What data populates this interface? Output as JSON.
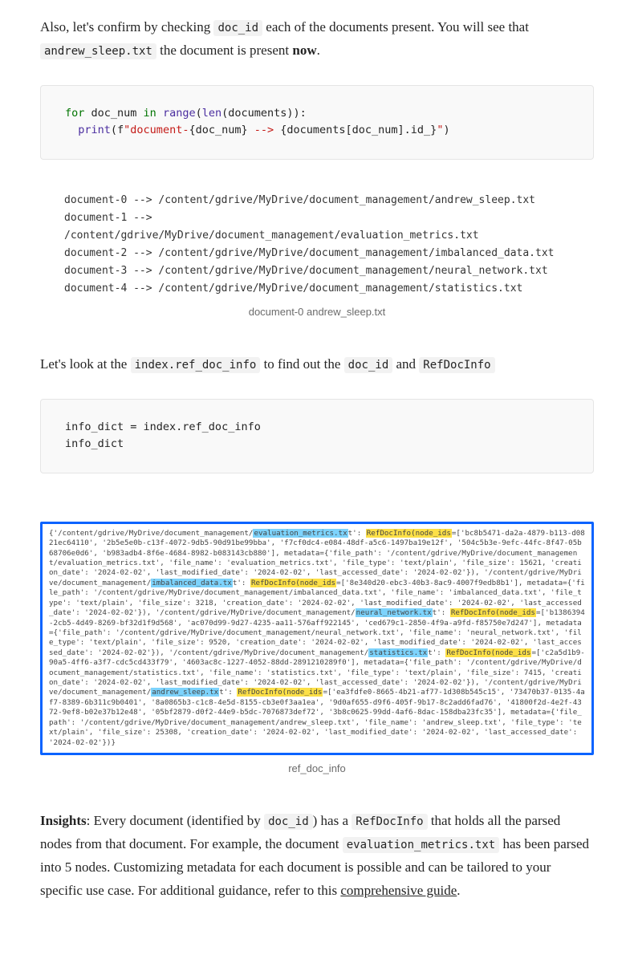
{
  "p1_a": "Also, let's confirm by checking ",
  "p1_b": " each of the documents present. You will see that ",
  "p1_c": " the document is present ",
  "p1_d": ".",
  "doc_id": "doc_id",
  "andrew_file": "andrew_sleep.txt",
  "now": "now",
  "code1": {
    "l1a": "for",
    "l1b": " doc_num ",
    "l1c": "in",
    "l1d": " ",
    "l1e": "range",
    "l1f": "(",
    "l1g": "len",
    "l1h": "(documents)):",
    "l2a": "  ",
    "l2b": "print",
    "l2c": "(f",
    "l2d": "\"document-",
    "l2e": "{doc_num}",
    "l2f": " --> ",
    "l2g": "{documents[doc_num].id_}",
    "l2h": "\"",
    "l2i": ")"
  },
  "out1": "document-0 --> /content/gdrive/MyDrive/document_management/andrew_sleep.txt\ndocument-1 --> /content/gdrive/MyDrive/document_management/evaluation_metrics.txt\ndocument-2 --> /content/gdrive/MyDrive/document_management/imbalanced_data.txt\ndocument-3 --> /content/gdrive/MyDrive/document_management/neural_network.txt\ndocument-4 --> /content/gdrive/MyDrive/document_management/statistics.txt",
  "cap1": "document-0 andrew_sleep.txt",
  "p2_a": "Let's look at the ",
  "p2_b": " to find out the ",
  "p2_c": " and ",
  "index_ref": "index.ref_doc_info",
  "refdoc": "RefDocInfo",
  "code2": "info_dict = index.ref_doc_info\ninfo_dict",
  "cap2": "ref_doc_info",
  "box": {
    "pre": "{'/content/gdrive/MyDrive/document_management/",
    "f1": "evaluation_metrics.tx",
    "t1": "t': ",
    "rd": "RefDocInfo(node_ids",
    "seg1": "=['bc8b5471-da2a-4879-b113-d0821ec64110', '2b5e5e0b-c13f-4072-9db5-90d91be99bba', 'f7cf0dc4-e084-48df-a5c6-1497ba19e12f', '504c5b3e-9efc-44fc-8f47-05b68706e0d6', 'b983adb4-8f6e-4684-8982-b083143cb880'], metadata={'file_path': '/content/gdrive/MyDrive/document_management/evaluation_metrics.txt', 'file_name': 'evaluation_metrics.txt', 'file_type': 'text/plain', 'file_size': 15621, 'creation_date': '2024-02-02', 'last_modified_date': '2024-02-02', 'last_accessed_date': '2024-02-02'}),\n'/content/gdrive/MyDrive/document_management/",
    "f2": "imbalanced_data.tx",
    "seg2": "=['8e340d20-ebc3-40b3-8ac9-4007f9edb8b1'], metadata={'file_path': '/content/gdrive/MyDrive/document_management/imbalanced_data.txt', 'file_name': 'imbalanced_data.txt', 'file_type': 'text/plain', 'file_size': 3218, 'creation_date': '2024-02-02', 'last_modified_date': '2024-02-02', 'last_accessed_date': '2024-02-02'}),\n'/content/gdrive/MyDrive/document_management/",
    "f3": "neural_network.tx",
    "seg3": "=['b1386394-2cb5-4d49-8269-bf32d1f9d568', 'ac070d99-9d27-4235-aa11-576aff922145', 'ced679c1-2850-4f9a-a9fd-f85750e7d247'], metadata={'file_path': '/content/gdrive/MyDrive/document_management/neural_network.txt', 'file_name': 'neural_network.txt', 'file_type': 'text/plain', 'file_size': 9520, 'creation_date': '2024-02-02', 'last_modified_date': '2024-02-02', 'last_accessed_date': '2024-02-02'}),\n'/content/gdrive/MyDrive/document_management/",
    "f4": "statistics.tx",
    "seg4": "=['c2a5d1b9-90a5-4ff6-a3f7-cdc5cd433f79', '4603ac8c-1227-4052-88dd-2891210289f0'], metadata={'file_path': '/content/gdrive/MyDrive/document_management/statistics.txt', 'file_name': 'statistics.txt', 'file_type': 'text/plain', 'file_size': 7415, 'creation_date': '2024-02-02', 'last_modified_date': '2024-02-02', 'last_accessed_date': '2024-02-02'}),\n'/content/gdrive/MyDrive/document_management/",
    "f5": "andrew_sleep.tx",
    "seg5": "=['ea3fdfe0-8665-4b21-af77-1d308b545c15', '73470b37-0135-4af7-8389-6b311c9b0401', '8a0865b3-c1c8-4e5d-8155-cb3e0f3aa1ea', '9d0af655-d9f6-405f-9b17-8c2add6fad76', '41800f2d-4e2f-4372-9ef8-b02e37b12e48', '05bf2879-d0f2-44e9-b5dc-7076873def72', '3b8c0625-99dd-4af6-8dac-158dba23fc35'], metadata={'file_path': '/content/gdrive/MyDrive/document_management/andrew_sleep.txt', 'file_name': 'andrew_sleep.txt', 'file_type': 'text/plain', 'file_size': 25308, 'creation_date': '2024-02-02', 'last_modified_date': '2024-02-02', 'last_accessed_date': '2024-02-02'})}"
  },
  "p3_a": "Insights",
  "p3_b": ": Every document (identified by ",
  "p3_c": ") has a ",
  "p3_d": " that holds all the parsed nodes from that document. For example, the document ",
  "p3_e": " has been parsed into 5 nodes. Customizing metadata for each document is possible and can be tailored to your specific use case. For additional guidance, refer to this ",
  "p3_f": ".",
  "eval_file": "evaluation_metrics.txt",
  "guide": "comprehensive guide"
}
